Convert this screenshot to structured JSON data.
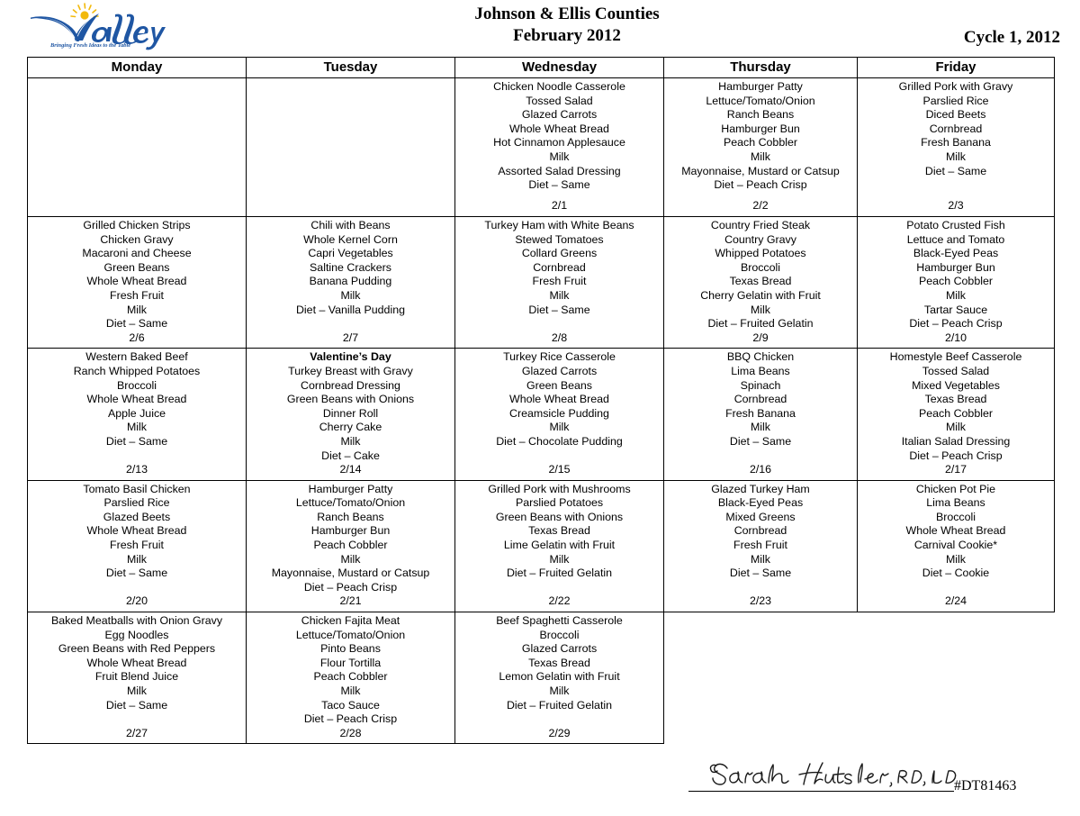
{
  "header": {
    "logo": {
      "name": "Valley",
      "tagline": "Bringing Fresh Ideas to the Table",
      "brand_color": "#1F56A3",
      "sun_color": "#F2B90C"
    },
    "title_line1": "Johnson & Ellis Counties",
    "title_line2": "February 2012",
    "cycle": "Cycle 1, 2012"
  },
  "columns": [
    "Monday",
    "Tuesday",
    "Wednesday",
    "Thursday",
    "Friday"
  ],
  "weeks": [
    {
      "cells": [
        {
          "present": true,
          "items": [],
          "date": ""
        },
        {
          "present": true,
          "items": [],
          "date": ""
        },
        {
          "present": true,
          "items": [
            "Chicken Noodle Casserole",
            "Tossed Salad",
            "Glazed Carrots",
            "Whole Wheat Bread",
            "Hot Cinnamon Applesauce",
            "Milk",
            "Assorted Salad Dressing",
            "Diet – Same"
          ],
          "date": "2/1"
        },
        {
          "present": true,
          "items": [
            "Hamburger Patty",
            "Lettuce/Tomato/Onion",
            "Ranch Beans",
            "Hamburger Bun",
            "Peach Cobbler",
            "Milk",
            "Mayonnaise, Mustard or Catsup",
            "Diet – Peach Crisp"
          ],
          "date": "2/2"
        },
        {
          "present": true,
          "items": [
            "Grilled Pork with Gravy",
            "Parslied Rice",
            "Diced Beets",
            "Cornbread",
            "Fresh Banana",
            "Milk",
            "Diet – Same"
          ],
          "date": "2/3"
        }
      ]
    },
    {
      "cells": [
        {
          "present": true,
          "items": [
            "Grilled Chicken Strips",
            "Chicken Gravy",
            "Macaroni and Cheese",
            "Green Beans",
            "Whole Wheat Bread",
            "Fresh Fruit",
            "Milk",
            "Diet – Same"
          ],
          "date": "2/6"
        },
        {
          "present": true,
          "items": [
            "Chili with Beans",
            "Whole Kernel Corn",
            "Capri Vegetables",
            "Saltine Crackers",
            "Banana Pudding",
            "Milk",
            "Diet – Vanilla Pudding"
          ],
          "date": "2/7"
        },
        {
          "present": true,
          "items": [
            "Turkey Ham with White Beans",
            "Stewed Tomatoes",
            "Collard Greens",
            "Cornbread",
            "Fresh Fruit",
            "Milk",
            "Diet – Same"
          ],
          "date": "2/8"
        },
        {
          "present": true,
          "items": [
            "Country Fried Steak",
            "Country Gravy",
            "Whipped Potatoes",
            "Broccoli",
            "Texas Bread",
            "Cherry Gelatin with Fruit",
            "Milk",
            "Diet – Fruited Gelatin"
          ],
          "date": "2/9"
        },
        {
          "present": true,
          "items": [
            "Potato Crusted Fish",
            "Lettuce and Tomato",
            "Black-Eyed Peas",
            "Hamburger Bun",
            "Peach Cobbler",
            "Milk",
            "Tartar Sauce",
            "Diet – Peach Crisp"
          ],
          "date": "2/10"
        }
      ]
    },
    {
      "cells": [
        {
          "present": true,
          "items": [
            "Western Baked Beef",
            "Ranch Whipped Potatoes",
            "Broccoli",
            "Whole Wheat Bread",
            "Apple Juice",
            "Milk",
            "Diet – Same"
          ],
          "date": "2/13"
        },
        {
          "present": true,
          "bold_first": true,
          "items": [
            "Valentine’s Day",
            "Turkey Breast with Gravy",
            "Cornbread Dressing",
            "Green Beans with Onions",
            "Dinner Roll",
            "Cherry Cake",
            "Milk",
            "Diet – Cake"
          ],
          "date": "2/14"
        },
        {
          "present": true,
          "items": [
            "Turkey Rice Casserole",
            "Glazed Carrots",
            "Green Beans",
            "Whole Wheat Bread",
            "Creamsicle Pudding",
            "Milk",
            "Diet – Chocolate Pudding"
          ],
          "date": "2/15"
        },
        {
          "present": true,
          "items": [
            "BBQ Chicken",
            "Lima Beans",
            "Spinach",
            "Cornbread",
            "Fresh Banana",
            "Milk",
            "Diet – Same"
          ],
          "date": "2/16"
        },
        {
          "present": true,
          "items": [
            "Homestyle Beef Casserole",
            "Tossed Salad",
            "Mixed Vegetables",
            "Texas Bread",
            "Peach Cobbler",
            "Milk",
            "Italian Salad Dressing",
            "Diet – Peach Crisp"
          ],
          "date": "2/17"
        }
      ]
    },
    {
      "cells": [
        {
          "present": true,
          "items": [
            "Tomato Basil Chicken",
            "Parslied Rice",
            "Glazed Beets",
            "Whole Wheat Bread",
            "Fresh Fruit",
            "Milk",
            "Diet – Same"
          ],
          "date": "2/20"
        },
        {
          "present": true,
          "items": [
            "Hamburger Patty",
            "Lettuce/Tomato/Onion",
            "Ranch Beans",
            "Hamburger Bun",
            "Peach Cobbler",
            "Milk",
            "Mayonnaise, Mustard or Catsup",
            "Diet – Peach Crisp"
          ],
          "date": "2/21"
        },
        {
          "present": true,
          "items": [
            "Grilled Pork with Mushrooms",
            "Parslied Potatoes",
            "Green Beans with Onions",
            "Texas Bread",
            "Lime Gelatin with Fruit",
            "Milk",
            "Diet – Fruited Gelatin"
          ],
          "date": "2/22"
        },
        {
          "present": true,
          "items": [
            "Glazed Turkey Ham",
            "Black-Eyed Peas",
            "Mixed Greens",
            "Cornbread",
            "Fresh Fruit",
            "Milk",
            "Diet – Same"
          ],
          "date": "2/23"
        },
        {
          "present": true,
          "items": [
            "Chicken Pot Pie",
            "Lima Beans",
            "Broccoli",
            "Whole Wheat Bread",
            "Carnival Cookie*",
            "Milk",
            "Diet – Cookie"
          ],
          "date": "2/24"
        }
      ]
    },
    {
      "cells": [
        {
          "present": true,
          "items": [
            "Baked Meatballs with Onion Gravy",
            "Egg Noodles",
            "Green Beans with Red Peppers",
            "Whole Wheat Bread",
            "Fruit Blend Juice",
            "Milk",
            "Diet – Same"
          ],
          "date": "2/27"
        },
        {
          "present": true,
          "items": [
            "Chicken Fajita Meat",
            "Lettuce/Tomato/Onion",
            "Pinto Beans",
            "Flour Tortilla",
            "Peach Cobbler",
            "Milk",
            "Taco Sauce",
            "Diet – Peach Crisp"
          ],
          "date": "2/28"
        },
        {
          "present": true,
          "items": [
            "Beef Spaghetti Casserole",
            "Broccoli",
            "Glazed Carrots",
            "Texas Bread",
            "Lemon Gelatin with Fruit",
            "Milk",
            "Diet – Fruited Gelatin"
          ],
          "date": "2/29"
        },
        {
          "present": false,
          "items": [],
          "date": ""
        },
        {
          "present": false,
          "items": [],
          "date": ""
        }
      ]
    }
  ],
  "footer": {
    "signature_text": "Sarah Hutsler, RD, LD",
    "document_id": "#DT81463"
  }
}
